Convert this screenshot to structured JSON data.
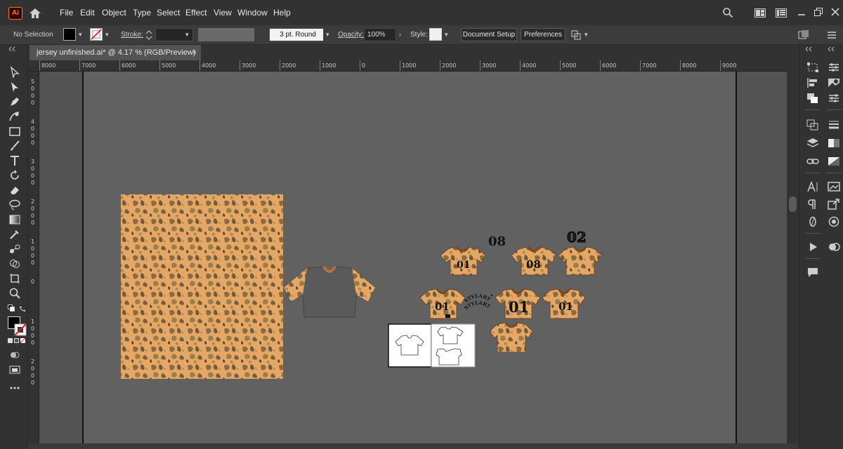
{
  "app": {
    "logo_text": "Ai"
  },
  "menu": [
    "File",
    "Edit",
    "Object",
    "Type",
    "Select",
    "Effect",
    "View",
    "Window",
    "Help"
  ],
  "control_bar": {
    "selection_status": "No Selection",
    "stroke_label": "Stroke:",
    "brush_value": "3 pt. Round",
    "opacity_label": "Opacity:",
    "opacity_value": "100%",
    "style_label": "Style:",
    "document_setup": "Document Setup",
    "preferences": "Preferences"
  },
  "tab": {
    "title": "jersey unfinished.ai* @ 4.17 % (RGB/Preview)",
    "close": "×"
  },
  "ruler": {
    "h_labels": [
      "8000",
      "7000",
      "6000",
      "5000",
      "4000",
      "3000",
      "2000",
      "1000",
      "0",
      "1000",
      "2000",
      "3000",
      "4000",
      "5000",
      "6000",
      "7000",
      "8000",
      "9000"
    ],
    "v_labels": [
      "5000",
      "4000",
      "3000",
      "2000",
      "1000",
      "0",
      "1000",
      "2000"
    ]
  },
  "artwork": {
    "numbers": [
      "08",
      "02",
      "01",
      "08",
      "01",
      "01",
      "01"
    ],
    "wordmark": "STYLART"
  },
  "colors": {
    "camo_base": "#e8a868",
    "camo_dark": "#7a5a3a",
    "camo_mid": "#b88a5a",
    "camo_olive": "#8a7a4a",
    "collar": "#c07040"
  }
}
